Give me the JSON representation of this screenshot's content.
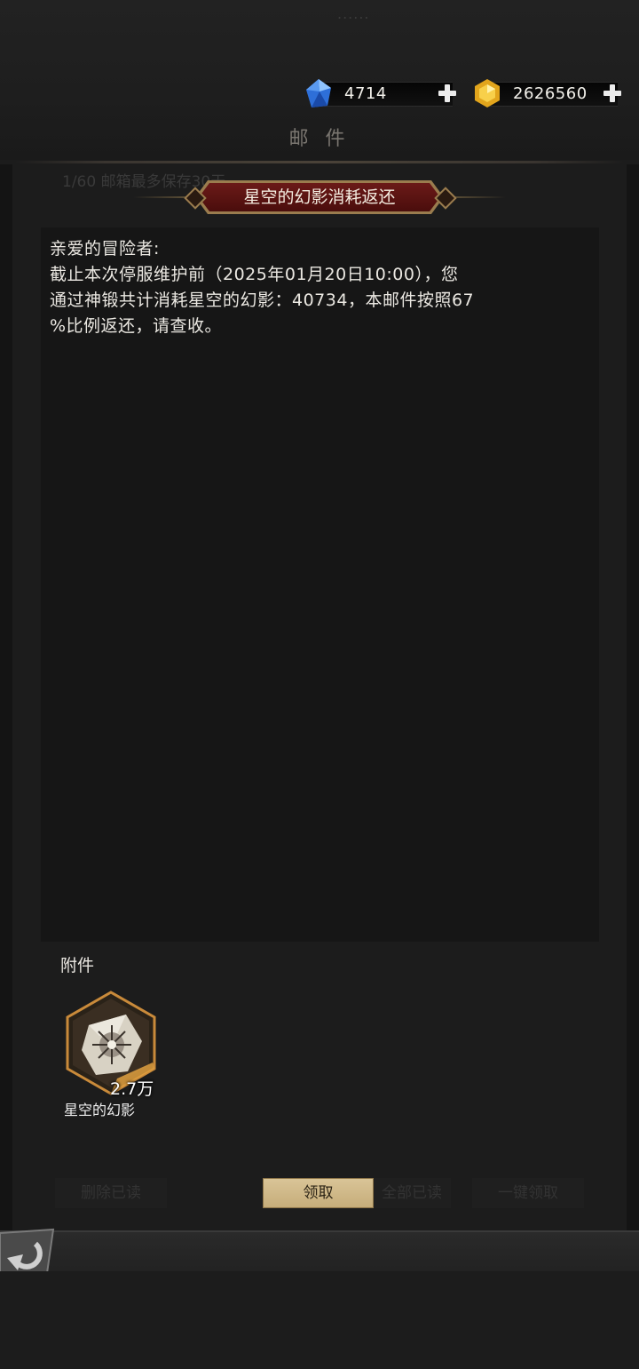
{
  "currency": {
    "crystal": {
      "value": "4714",
      "icon": "blue-crystal-icon"
    },
    "gold": {
      "value": "2626560",
      "icon": "gold-gem-icon"
    }
  },
  "page": {
    "title": "邮 件",
    "faint_top": "......",
    "bg_text": "1/60 邮箱最多保存30天"
  },
  "mail": {
    "subject": "星空的幻影消耗返还",
    "greeting": "亲爱的冒险者:",
    "body_line1": "截止本次停服维护前（2025年01月20日10:00），您",
    "body_line2": "通过神锻共计消耗星空的幻影：40734，本邮件按照67",
    "body_line3": "%比例返还，请查收。"
  },
  "attachments": {
    "label": "附件",
    "items": [
      {
        "name": "星空的幻影",
        "count": "2.7万",
        "icon": "starry-phantom-icon"
      }
    ]
  },
  "buttons": {
    "claim": "领取",
    "ghost_left": "删除已读",
    "ghost_mid": "全部已读",
    "ghost_right": "一键领取"
  },
  "colors": {
    "banner_red": "#6b1a18",
    "banner_gold": "#9a7c4e",
    "claim_button": "#d9c497"
  }
}
